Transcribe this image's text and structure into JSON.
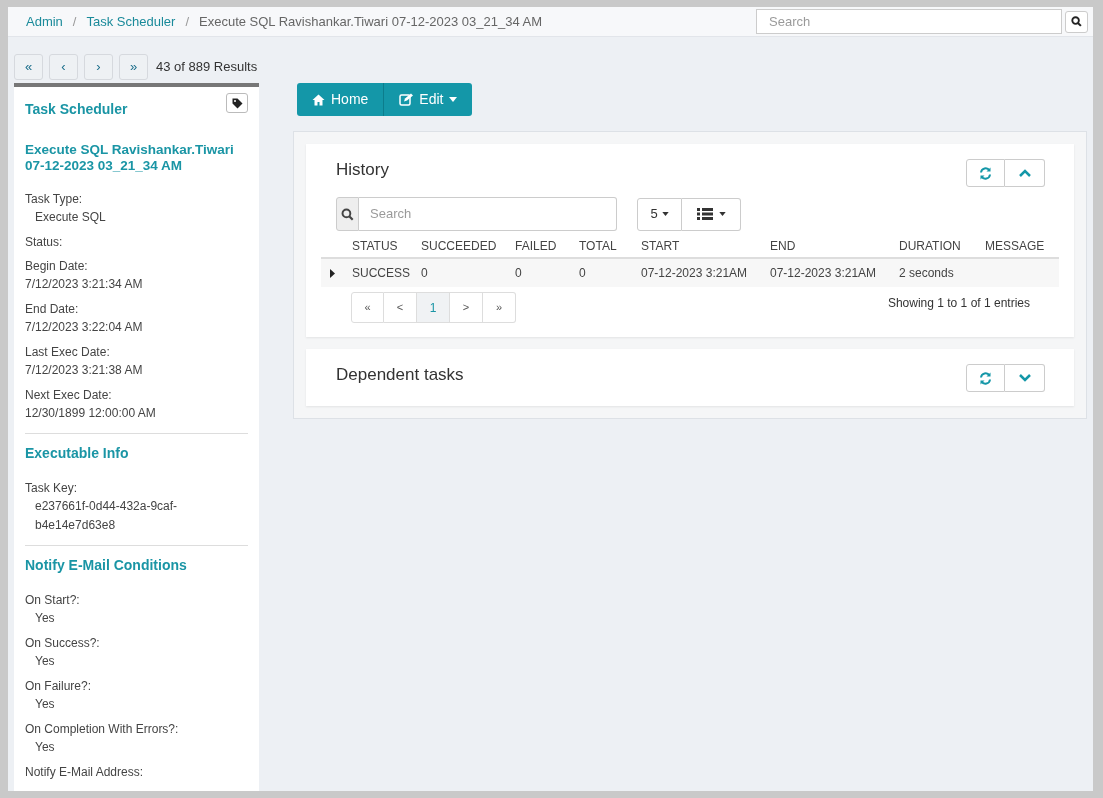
{
  "breadcrumb": [
    {
      "kind": "link",
      "label": "Admin"
    },
    {
      "kind": "separator",
      "label": "/"
    },
    {
      "kind": "link",
      "label": "Task Scheduler"
    },
    {
      "kind": "separator",
      "label": "/"
    },
    {
      "kind": "current",
      "label": "Execute SQL Ravishankar.Tiwari 07-12-2023 03_21_34 AM"
    }
  ],
  "top_search": {
    "placeholder": "Search"
  },
  "pager": {
    "buttons": [
      "«",
      "‹",
      "›",
      "»"
    ],
    "results": "43 of 889 Results"
  },
  "toolbar": [
    {
      "label": "Home",
      "dropdown": false
    },
    {
      "label": "Edit",
      "dropdown": true
    }
  ],
  "sidebar": {
    "title": "Task Scheduler",
    "heading": "Execute SQL Ravishankar.Tiwari 07-12-2023 03_21_34 AM",
    "sections": [
      {
        "fields": [
          {
            "label": "Task Type:",
            "value": "Execute SQL",
            "indented": true
          },
          {
            "label": "Status:",
            "indented": false
          },
          {
            "label": "Begin Date:",
            "value": "7/12/2023 3:21:34 AM",
            "indented": false
          },
          {
            "label": "End Date:",
            "value": "7/12/2023 3:22:04 AM",
            "indented": false
          },
          {
            "label": "Last Exec Date:",
            "value": "7/12/2023 3:21:38 AM",
            "indented": false
          },
          {
            "label": "Next Exec Date:",
            "value": "12/30/1899 12:00:00 AM",
            "indented": false
          }
        ]
      },
      {
        "title": "Executable Info",
        "fields": [
          {
            "label": "Task Key:",
            "value": "e237661f-0d44-432a-9caf-b4e14e7d63e8",
            "indented": true
          }
        ]
      },
      {
        "title": "Notify E-Mail Conditions",
        "fields": [
          {
            "label": "On Start?:",
            "value": "Yes",
            "indented": true
          },
          {
            "label": "On Success?:",
            "value": "Yes",
            "indented": true
          },
          {
            "label": "On Failure?:",
            "value": "Yes",
            "indented": true
          },
          {
            "label": "On Completion With Errors?:",
            "value": "Yes",
            "indented": true
          },
          {
            "label": "Notify E-Mail Address:",
            "indented": false
          }
        ]
      }
    ]
  },
  "panels": [
    {
      "title": "History",
      "expanded": true,
      "search": {
        "placeholder": "Search"
      },
      "page_size": "5",
      "table": {
        "columns": [
          "STATUS",
          "SUCCEEDED",
          "FAILED",
          "TOTAL",
          "START",
          "END",
          "DURATION",
          "MESSAGE"
        ],
        "rows": [
          {
            "expanded": false,
            "cells": [
              "SUCCESS",
              "0",
              "0",
              "0",
              "07-12-2023 3:21AM",
              "07-12-2023 3:21AM",
              "2 seconds",
              ""
            ]
          }
        ]
      },
      "pagination": [
        {
          "label": "«",
          "selected": false
        },
        {
          "label": "<",
          "selected": false
        },
        {
          "label": "1",
          "selected": true
        },
        {
          "label": ">",
          "selected": false
        },
        {
          "label": "»",
          "selected": false
        }
      ],
      "info": "Showing 1 to 1 of 1 entries"
    },
    {
      "title": "Dependent tasks",
      "expanded": false
    }
  ]
}
